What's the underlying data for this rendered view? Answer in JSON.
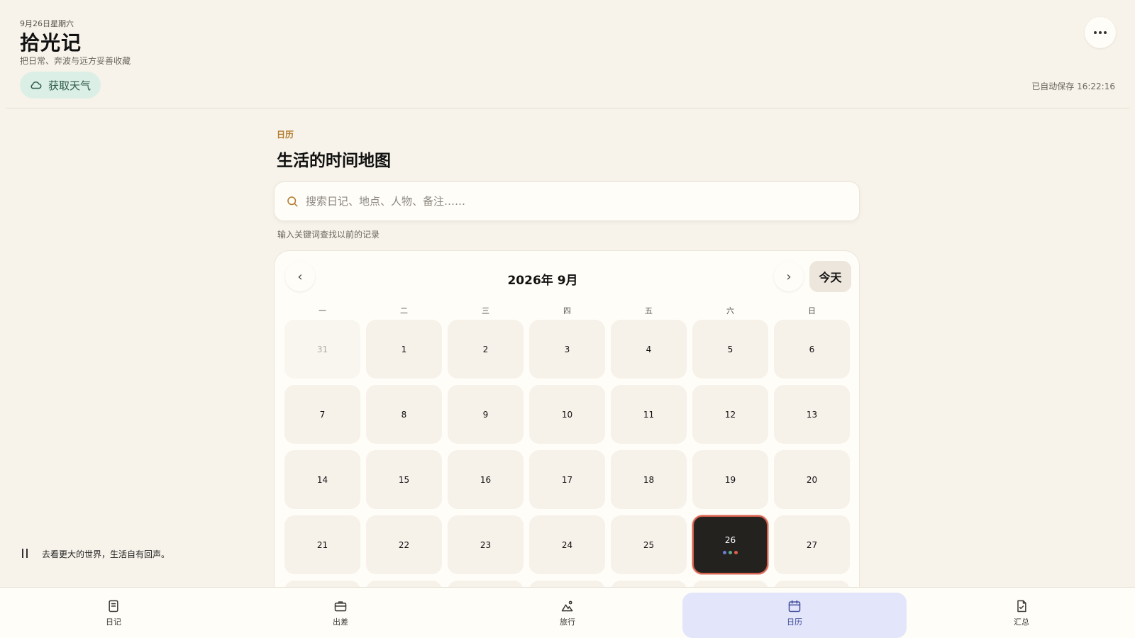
{
  "header": {
    "date": "9月26日星期六",
    "title": "拾光记",
    "tagline": "把日常、奔波与远方妥善收藏",
    "weather_label": "获取天气",
    "saved_status": "已自动保存 16:22:16"
  },
  "main": {
    "kicker": "日历",
    "title": "生活的时间地图",
    "search_placeholder": "搜索日记、地点、人物、备注……",
    "search_hint": "输入关键词查找以前的记录"
  },
  "calendar": {
    "month_label": "2026年 9月",
    "prev_label": "‹",
    "next_label": "›",
    "today_label": "今天",
    "weekdays": [
      "一",
      "二",
      "三",
      "四",
      "五",
      "六",
      "日"
    ],
    "days": [
      {
        "label": "31",
        "outside": true
      },
      {
        "label": "1"
      },
      {
        "label": "2"
      },
      {
        "label": "3"
      },
      {
        "label": "4"
      },
      {
        "label": "5"
      },
      {
        "label": "6"
      },
      {
        "label": "7"
      },
      {
        "label": "8"
      },
      {
        "label": "9"
      },
      {
        "label": "10"
      },
      {
        "label": "11"
      },
      {
        "label": "12"
      },
      {
        "label": "13"
      },
      {
        "label": "14"
      },
      {
        "label": "15"
      },
      {
        "label": "16"
      },
      {
        "label": "17"
      },
      {
        "label": "18"
      },
      {
        "label": "19"
      },
      {
        "label": "20"
      },
      {
        "label": "21"
      },
      {
        "label": "22"
      },
      {
        "label": "23"
      },
      {
        "label": "24"
      },
      {
        "label": "25"
      },
      {
        "label": "26",
        "today": true,
        "dots": [
          "#6d7ed8",
          "#5fa88a",
          "#e0604c"
        ]
      },
      {
        "label": "27"
      },
      {
        "label": ""
      },
      {
        "label": ""
      },
      {
        "label": ""
      },
      {
        "label": ""
      },
      {
        "label": ""
      },
      {
        "label": ""
      },
      {
        "label": ""
      }
    ]
  },
  "quote": {
    "text": "去看更大的世界，生活自有回声。"
  },
  "bottom_nav": [
    {
      "label": "日记",
      "icon": "journal-icon"
    },
    {
      "label": "出差",
      "icon": "briefcase-icon"
    },
    {
      "label": "旅行",
      "icon": "mountain-icon"
    },
    {
      "label": "日历",
      "icon": "calendar-icon",
      "active": true
    },
    {
      "label": "汇总",
      "icon": "summary-document-icon"
    }
  ],
  "colors": {
    "background": "#f7f3ea",
    "accent_kicker": "#b27b2d",
    "weather_bg": "#dcefe6",
    "today_bg": "#24221f",
    "today_border": "#d9614e",
    "nav_active_bg": "#e3e6fa"
  }
}
